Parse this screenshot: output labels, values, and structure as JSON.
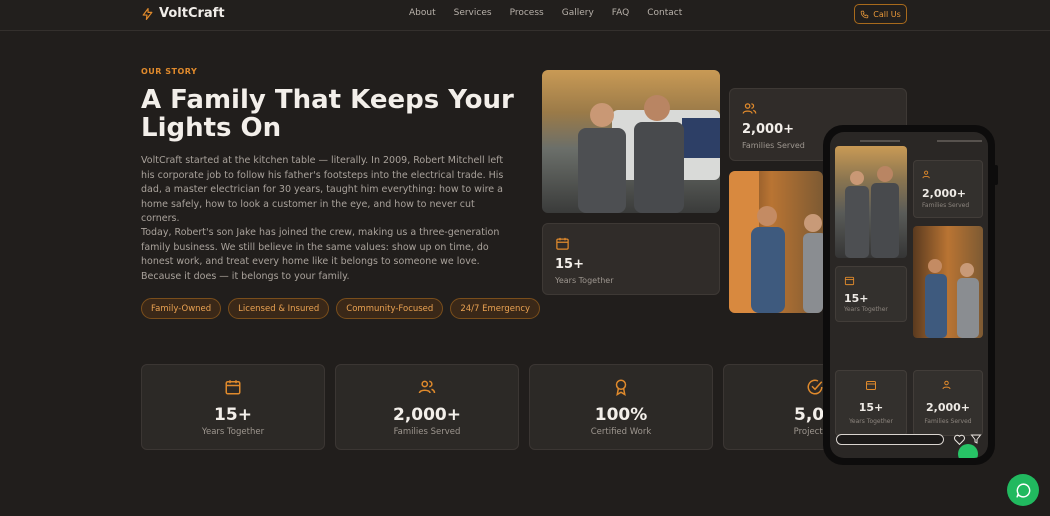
{
  "nav": {
    "brand": "VoltCraft",
    "links": [
      "About",
      "Services",
      "Process",
      "Gallery",
      "FAQ",
      "Contact"
    ],
    "cta": "Call Us"
  },
  "story": {
    "eyebrow": "OUR STORY",
    "title": "A Family That Keeps Your Lights On",
    "p1": "VoltCraft started at the kitchen table — literally. In 2009, Robert Mitchell left his corporate job to follow his father's footsteps into the electrical trade. His dad, a master electrician for 30 years, taught him everything: how to wire a home safely, how to look a customer in the eye, and how to never cut corners.",
    "p2": "Today, Robert's son Jake has joined the crew, making us a three-generation family business. We still believe in the same values: show up on time, do honest work, and treat every home like it belongs to someone we love. Because it does — it belongs to your family.",
    "tags": [
      "Family-Owned",
      "Licensed & Insured",
      "Community-Focused",
      "24/7 Emergency"
    ]
  },
  "gallery_cards": {
    "families": {
      "value": "2,000+",
      "label": "Families Served"
    },
    "years": {
      "value": "15+",
      "label": "Years Together"
    }
  },
  "stats": [
    {
      "icon": "calendar-icon",
      "value": "15+",
      "label": "Years Together"
    },
    {
      "icon": "users-icon",
      "value": "2,000+",
      "label": "Families Served"
    },
    {
      "icon": "award-icon",
      "value": "100%",
      "label": "Certified Work"
    },
    {
      "icon": "check-circle-icon",
      "value": "5,00",
      "label": "Projects D"
    }
  ],
  "phone": {
    "card_families": {
      "value": "2,000+",
      "label": "Families Served"
    },
    "card_years": {
      "value": "15+",
      "label": "Years Together"
    },
    "stat_years": {
      "value": "15+",
      "label": "Years Together"
    },
    "stat_families": {
      "value": "2,000+",
      "label": "Families Served"
    }
  },
  "colors": {
    "accent": "#e08a2c",
    "background": "#211e1c",
    "card": "#2c2926",
    "whatsapp": "#21b95f"
  }
}
